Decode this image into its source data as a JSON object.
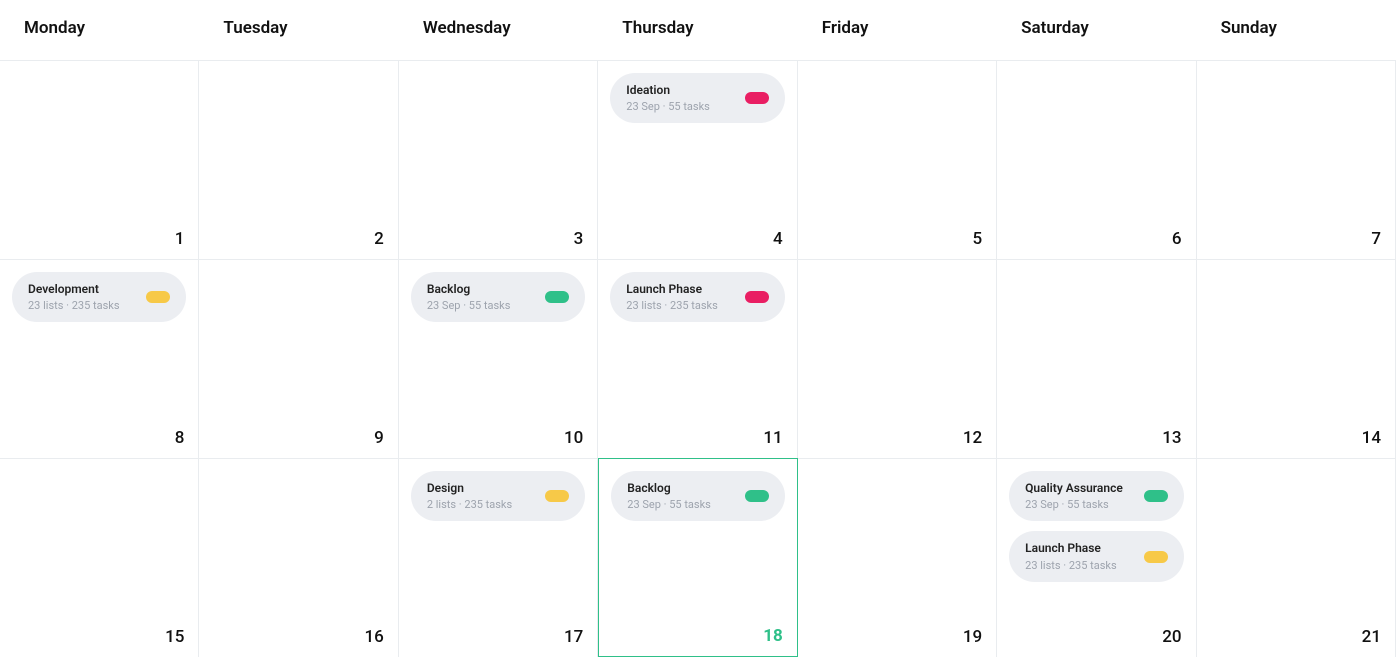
{
  "weekdays": [
    "Monday",
    "Tuesday",
    "Wednesday",
    "Thursday",
    "Friday",
    "Saturday",
    "Sunday"
  ],
  "cells": [
    {
      "num": "1"
    },
    {
      "num": "2"
    },
    {
      "num": "3"
    },
    {
      "num": "4",
      "chips": [
        {
          "title": "Ideation",
          "sub": "23 Sep · 55 tasks",
          "color": "pink"
        }
      ]
    },
    {
      "num": "5"
    },
    {
      "num": "6"
    },
    {
      "num": "7",
      "colEnd": true
    },
    {
      "num": "8",
      "chips": [
        {
          "title": "Development",
          "sub": "23 lists · 235 tasks",
          "color": "yellow"
        }
      ]
    },
    {
      "num": "9"
    },
    {
      "num": "10",
      "chips": [
        {
          "title": "Backlog",
          "sub": "23 Sep · 55 tasks",
          "color": "green"
        }
      ]
    },
    {
      "num": "11",
      "chips": [
        {
          "title": "Launch Phase",
          "sub": "23 lists · 235 tasks",
          "color": "pink"
        }
      ]
    },
    {
      "num": "12"
    },
    {
      "num": "13"
    },
    {
      "num": "14",
      "colEnd": true
    },
    {
      "num": "15"
    },
    {
      "num": "16"
    },
    {
      "num": "17",
      "chips": [
        {
          "title": "Design",
          "sub": "2 lists · 235 tasks",
          "color": "yellow"
        }
      ]
    },
    {
      "num": "18",
      "today": true,
      "chips": [
        {
          "title": "Backlog",
          "sub": "23 Sep · 55 tasks",
          "color": "green"
        }
      ]
    },
    {
      "num": "19"
    },
    {
      "num": "20",
      "chips": [
        {
          "title": "Quality Assurance",
          "sub": "23 Sep · 55 tasks",
          "color": "green"
        },
        {
          "title": "Launch Phase",
          "sub": "23 lists · 235 tasks",
          "color": "yellow"
        }
      ]
    },
    {
      "num": "21",
      "colEnd": true
    }
  ]
}
